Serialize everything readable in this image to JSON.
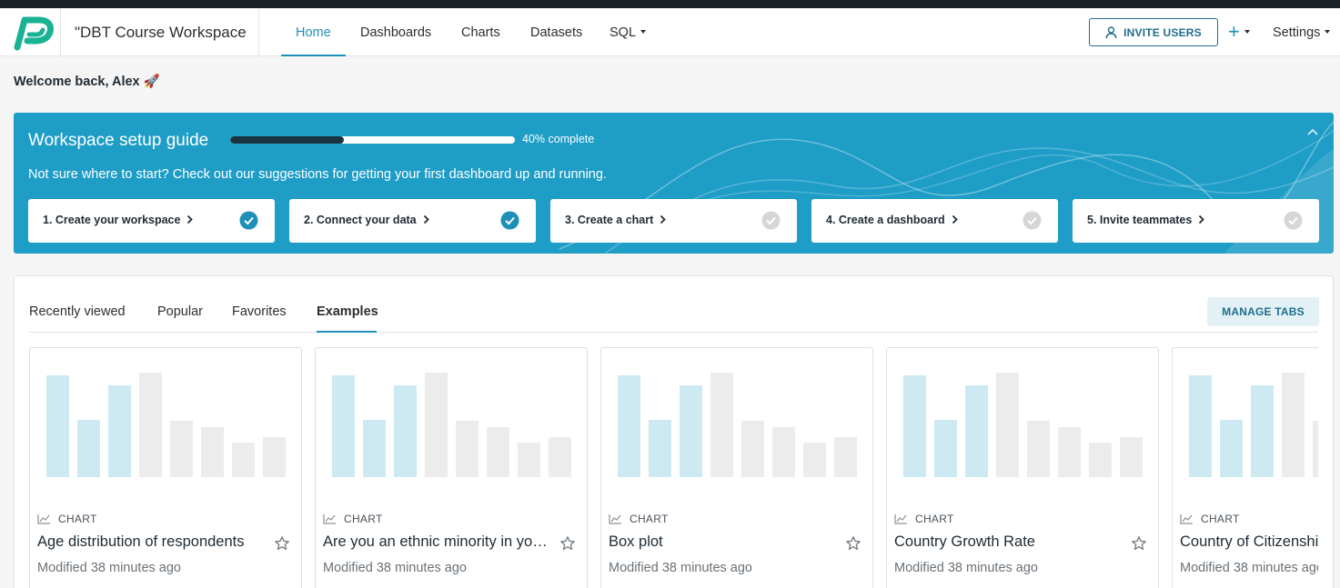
{
  "colors": {
    "brand": "#1e9dc7",
    "accent": "#1e8fb8",
    "dark": "#1a3441",
    "logo": "#19b394"
  },
  "header": {
    "workspace_name": "\"DBT Course Workspace",
    "nav": [
      {
        "label": "Home",
        "active": true
      },
      {
        "label": "Dashboards"
      },
      {
        "label": "Charts"
      },
      {
        "label": "Datasets"
      },
      {
        "label": "SQL",
        "has_caret": true
      }
    ],
    "invite_label": "INVITE USERS",
    "plus_label": "+",
    "settings_label": "Settings"
  },
  "welcome": "Welcome back, Alex 🚀",
  "guide": {
    "title": "Workspace setup guide",
    "progress_fraction": 0.4,
    "progress_label": "40% complete",
    "subtitle": "Not sure where to start? Check out our suggestions for getting your first dashboard up and running.",
    "steps": [
      {
        "label": "1. Create your workspace",
        "done": true
      },
      {
        "label": "2. Connect your data",
        "done": true
      },
      {
        "label": "3. Create a chart",
        "done": false
      },
      {
        "label": "4. Create a dashboard",
        "done": false
      },
      {
        "label": "5. Invite teammates",
        "done": false
      }
    ]
  },
  "content": {
    "tabs": [
      {
        "label": "Recently viewed"
      },
      {
        "label": "Popular"
      },
      {
        "label": "Favorites"
      },
      {
        "label": "Examples",
        "active": true
      }
    ],
    "manage_tabs_label": "MANAGE TABS",
    "cards": [
      {
        "kind": "CHART",
        "title": "Age distribution of respondents",
        "modified": "Modified 38 minutes ago"
      },
      {
        "kind": "CHART",
        "title": "Are you an ethnic minority in your country?",
        "modified": "Modified 38 minutes ago"
      },
      {
        "kind": "CHART",
        "title": "Box plot",
        "modified": "Modified 38 minutes ago"
      },
      {
        "kind": "CHART",
        "title": "Country Growth Rate",
        "modified": "Modified 38 minutes ago"
      },
      {
        "kind": "CHART",
        "title": "Country of Citizenship",
        "modified": "Modified 38 minutes ago"
      }
    ]
  }
}
